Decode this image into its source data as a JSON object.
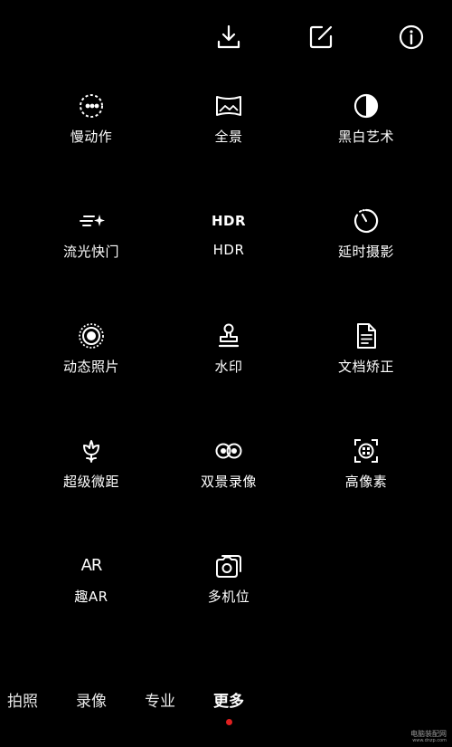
{
  "top_actions": {
    "download": "download-icon",
    "edit": "edit-icon",
    "info": "info-icon"
  },
  "modes": [
    {
      "label": "慢动作",
      "icon": "slow-motion-icon"
    },
    {
      "label": "全景",
      "icon": "panorama-icon"
    },
    {
      "label": "黑白艺术",
      "icon": "monochrome-icon"
    },
    {
      "label": "流光快门",
      "icon": "light-painting-icon",
      "icon_text": ""
    },
    {
      "label": "HDR",
      "icon": "hdr-icon",
      "icon_text": "HDR"
    },
    {
      "label": "延时摄影",
      "icon": "time-lapse-icon"
    },
    {
      "label": "动态照片",
      "icon": "moving-picture-icon"
    },
    {
      "label": "水印",
      "icon": "watermark-stamp-icon"
    },
    {
      "label": "文档矫正",
      "icon": "document-scan-icon"
    },
    {
      "label": "超级微距",
      "icon": "super-macro-icon"
    },
    {
      "label": "双景录像",
      "icon": "dual-view-icon"
    },
    {
      "label": "高像素",
      "icon": "high-resolution-icon"
    },
    {
      "label": "趣AR",
      "icon": "ar-icon",
      "icon_text": "AR"
    },
    {
      "label": "多机位",
      "icon": "multi-camera-icon"
    }
  ],
  "bottom_tabs": [
    {
      "label": "拍照",
      "active": false
    },
    {
      "label": "录像",
      "active": false
    },
    {
      "label": "专业",
      "active": false
    },
    {
      "label": "更多",
      "active": true
    }
  ],
  "active_dot_color": "#e02020",
  "watermark": {
    "line1": "电脑装配网",
    "line2": "www.dnzp.com"
  }
}
